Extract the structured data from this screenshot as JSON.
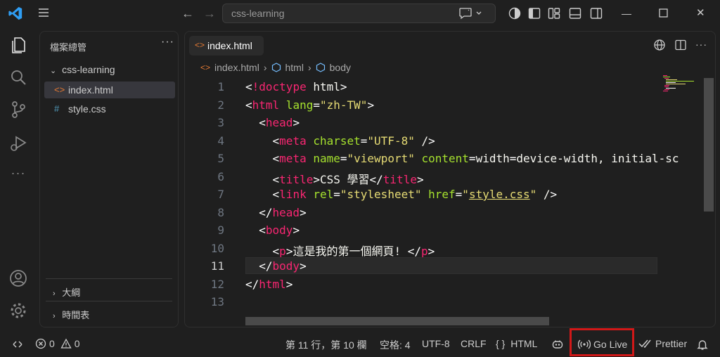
{
  "titlebar": {
    "search_text": "css-learning",
    "nav_back": "←",
    "nav_forward": "→",
    "window_minimize": "—",
    "window_close": "✕"
  },
  "sidebar": {
    "title": "檔案總管",
    "more": "···",
    "folder": "css-learning",
    "files": [
      {
        "name": "index.html",
        "icon": "<>",
        "icon_color": "#e37933"
      },
      {
        "name": "style.css",
        "icon": "#",
        "icon_color": "#519aba"
      }
    ],
    "sections": [
      "大綱",
      "時間表"
    ]
  },
  "editor": {
    "tab_label": "index.html",
    "tab_icon": "<>",
    "breadcrumb": [
      "index.html",
      "html",
      "body"
    ],
    "current_line": 11,
    "line_numbers": [
      "1",
      "2",
      "3",
      "4",
      "5",
      "6",
      "7",
      "8",
      "9",
      "10",
      "11",
      "12",
      "13"
    ],
    "code_lines": [
      "<!doctype html>",
      "<html lang=\"zh-TW\">",
      "  <head>",
      "    <meta charset=\"UTF-8\" />",
      "    <meta name=\"viewport\" content=\"width=device-width, initial-sc",
      "    <title>CSS 學習</title>",
      "    <link rel=\"stylesheet\" href=\"style.css\" />",
      "  </head>",
      "  <body>",
      "    <p>這是我的第一個網頁! </p>",
      "  </body>",
      "</html>",
      ""
    ]
  },
  "status": {
    "errors": "0",
    "warnings": "0",
    "position": "第 11 行，第 10 欄",
    "indent": "空格: 4",
    "encoding": "UTF-8",
    "eol": "CRLF",
    "language": "HTML",
    "language_icon": "{ }",
    "golive": "Go Live",
    "prettier": "Prettier"
  },
  "colors": {
    "accent": "#0078d4",
    "highlight_box": "#d11818",
    "tag": "#f92672",
    "attribute": "#a6e22e",
    "string": "#e6db74"
  }
}
